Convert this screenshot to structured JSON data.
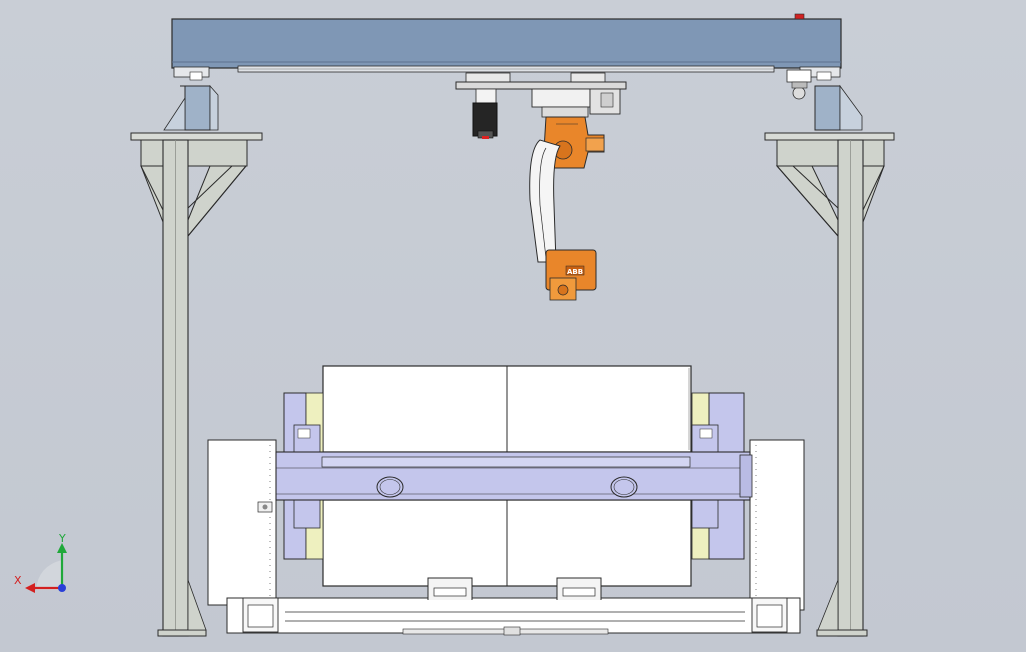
{
  "viewport": {
    "background": "#c6cbd3"
  },
  "colors": {
    "gantry_blue": "#7f97b5",
    "column_gray": "#cfd3cc",
    "robot_orange": "#e9862a",
    "positioner_lavender": "#c4c6ec",
    "pad_yellow": "#eef0bf",
    "white_panel": "#ffffff",
    "outline": "#2b2b2b"
  },
  "robot": {
    "badge_text": "ABB"
  },
  "triad": {
    "x_label": "X",
    "y_label": "Y",
    "x_color": "#d32020",
    "y_color": "#1fa83a",
    "z_color": "#2a3fd8"
  }
}
